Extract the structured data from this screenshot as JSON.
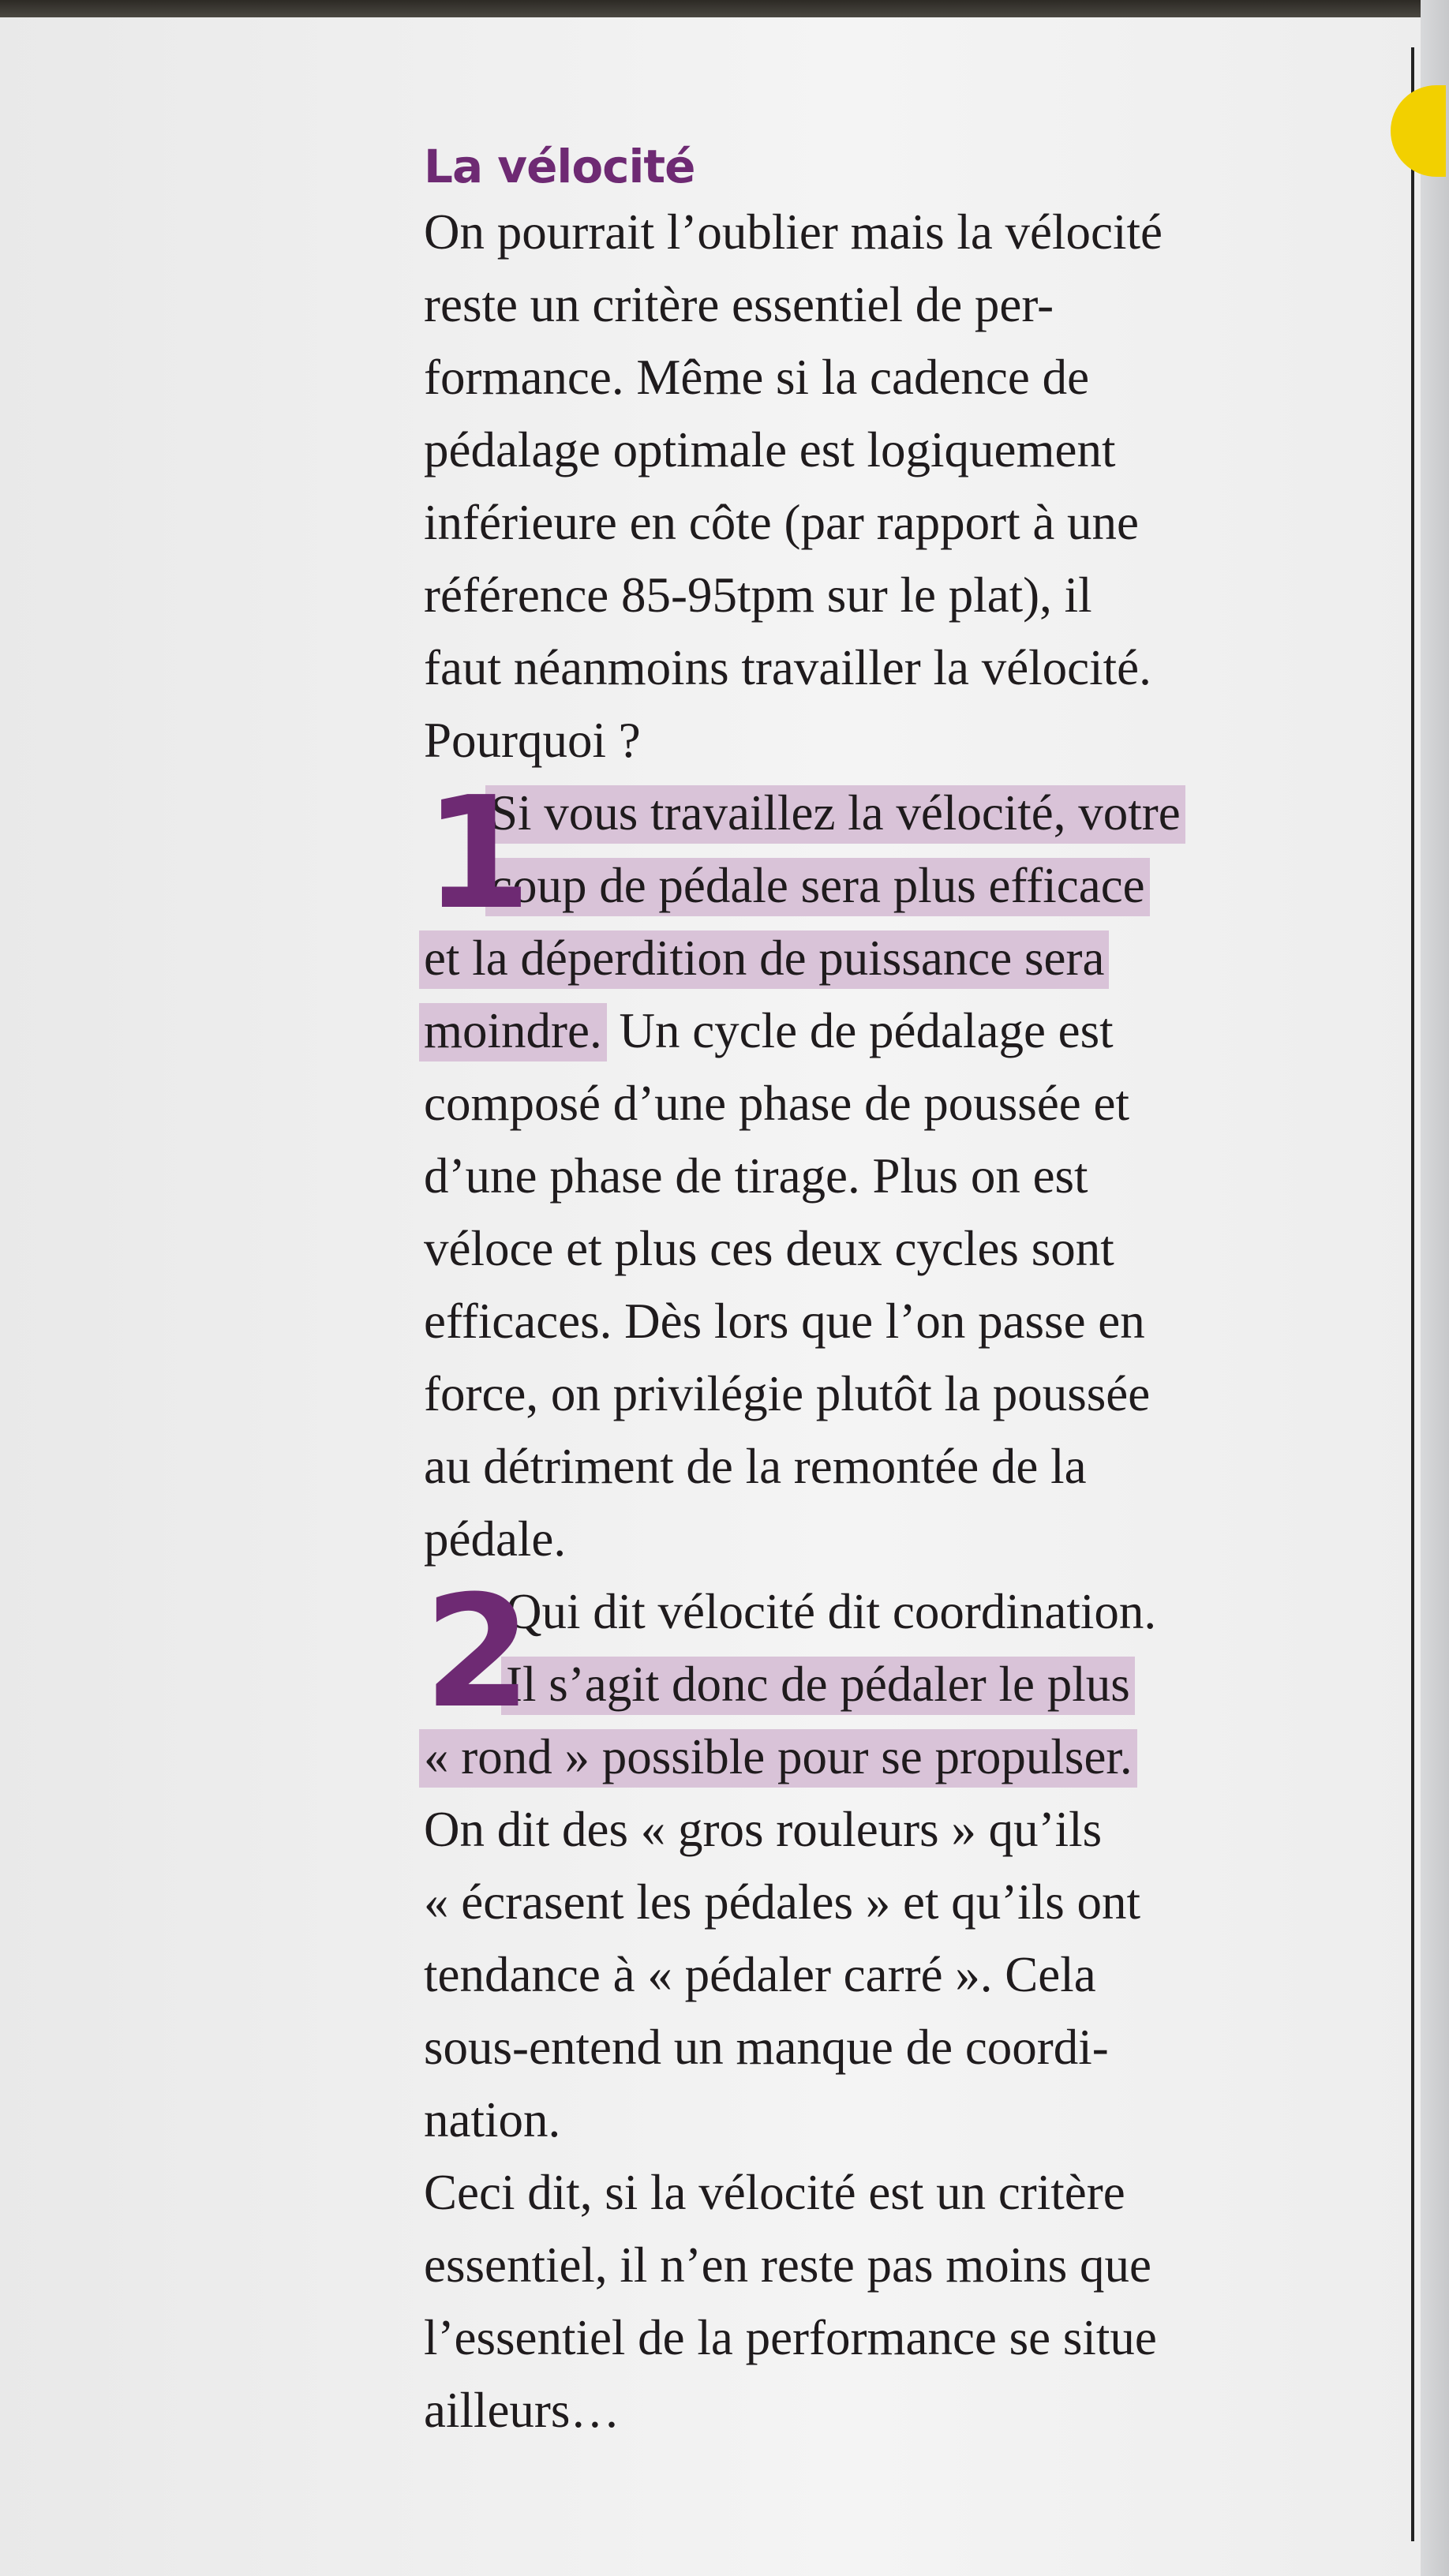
{
  "article": {
    "title": "La vélocité",
    "intro_lines": [
      "On pourrait l’oublier mais la vélocité",
      "reste un critère essentiel de per-",
      "formance. Même si la cadence de",
      "pédalage optimale est logiquement",
      "inférieure en côte (par rapport à une",
      "référence 85-95tpm sur le plat), il",
      "faut néanmoins travailler la vélocité.",
      "Pourquoi ?"
    ],
    "point1": {
      "number": "1",
      "line1": "Si vous travaillez la vélocité, votre",
      "line2": "coup de pédale sera plus efficace",
      "line3": "et la déperdition de puissance sera",
      "line4_highlight": "moindre.",
      "line4_rest": " Un cycle de pédalage est",
      "rest_lines": [
        "composé d’une phase de poussée et",
        "d’une phase de tirage. Plus on est",
        "véloce et plus ces deux cycles sont",
        "efficaces. Dès lors que l’on passe en",
        "force, on privilégie plutôt la poussée",
        "au détriment de la remontée de la",
        "pédale."
      ]
    },
    "point2": {
      "number": "2",
      "line1": "Qui dit vélocité dit coordination.",
      "line2": "Il s’agit donc de pédaler le plus",
      "line3": "« rond » possible pour se propulser.",
      "rest_lines": [
        "On dit des « gros rouleurs » qu’ils",
        "« écrasent les pédales » et qu’ils ont",
        "tendance à « pédaler carré ». Cela",
        "sous-entend un manque de coordi-",
        "nation."
      ]
    },
    "closing_lines": [
      "Ceci dit, si la vélocité est un critère",
      "essentiel, il n’en reste pas moins que",
      "l’essentiel de la performance se situe",
      "ailleurs…"
    ]
  },
  "colors": {
    "accent": "#6e2a73",
    "highlight": "#d9c3d8",
    "tab": "#f2d000",
    "text": "#1f1b1d"
  }
}
